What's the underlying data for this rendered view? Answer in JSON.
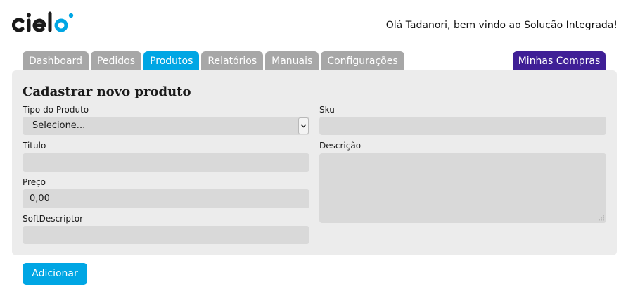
{
  "brand": {
    "name": "cielo",
    "color": "#1a1a1a",
    "accent": "#00a6e4"
  },
  "header": {
    "greeting": "Olá Tadanori, bem vindo ao Solução Integrada!"
  },
  "nav": {
    "tabs": [
      {
        "label": "Dashboard",
        "active": false
      },
      {
        "label": "Pedidos",
        "active": false
      },
      {
        "label": "Produtos",
        "active": true
      },
      {
        "label": "Relatórios",
        "active": false
      },
      {
        "label": "Manuais",
        "active": false
      },
      {
        "label": "Configurações",
        "active": false
      }
    ],
    "cart_tab": {
      "label": "Minhas Compras",
      "color": "#3f1f96"
    }
  },
  "form": {
    "title": "Cadastrar novo produto",
    "tipo": {
      "label": "Tipo do Produto",
      "selected": "Selecione..."
    },
    "titulo": {
      "label": "Titulo",
      "value": ""
    },
    "preco": {
      "label": "Preço",
      "value": "0,00"
    },
    "softdescriptor": {
      "label": "SoftDescriptor",
      "value": ""
    },
    "sku": {
      "label": "Sku",
      "value": ""
    },
    "descricao": {
      "label": "Descrição",
      "value": ""
    }
  },
  "actions": {
    "add_label": "Adicionar"
  }
}
